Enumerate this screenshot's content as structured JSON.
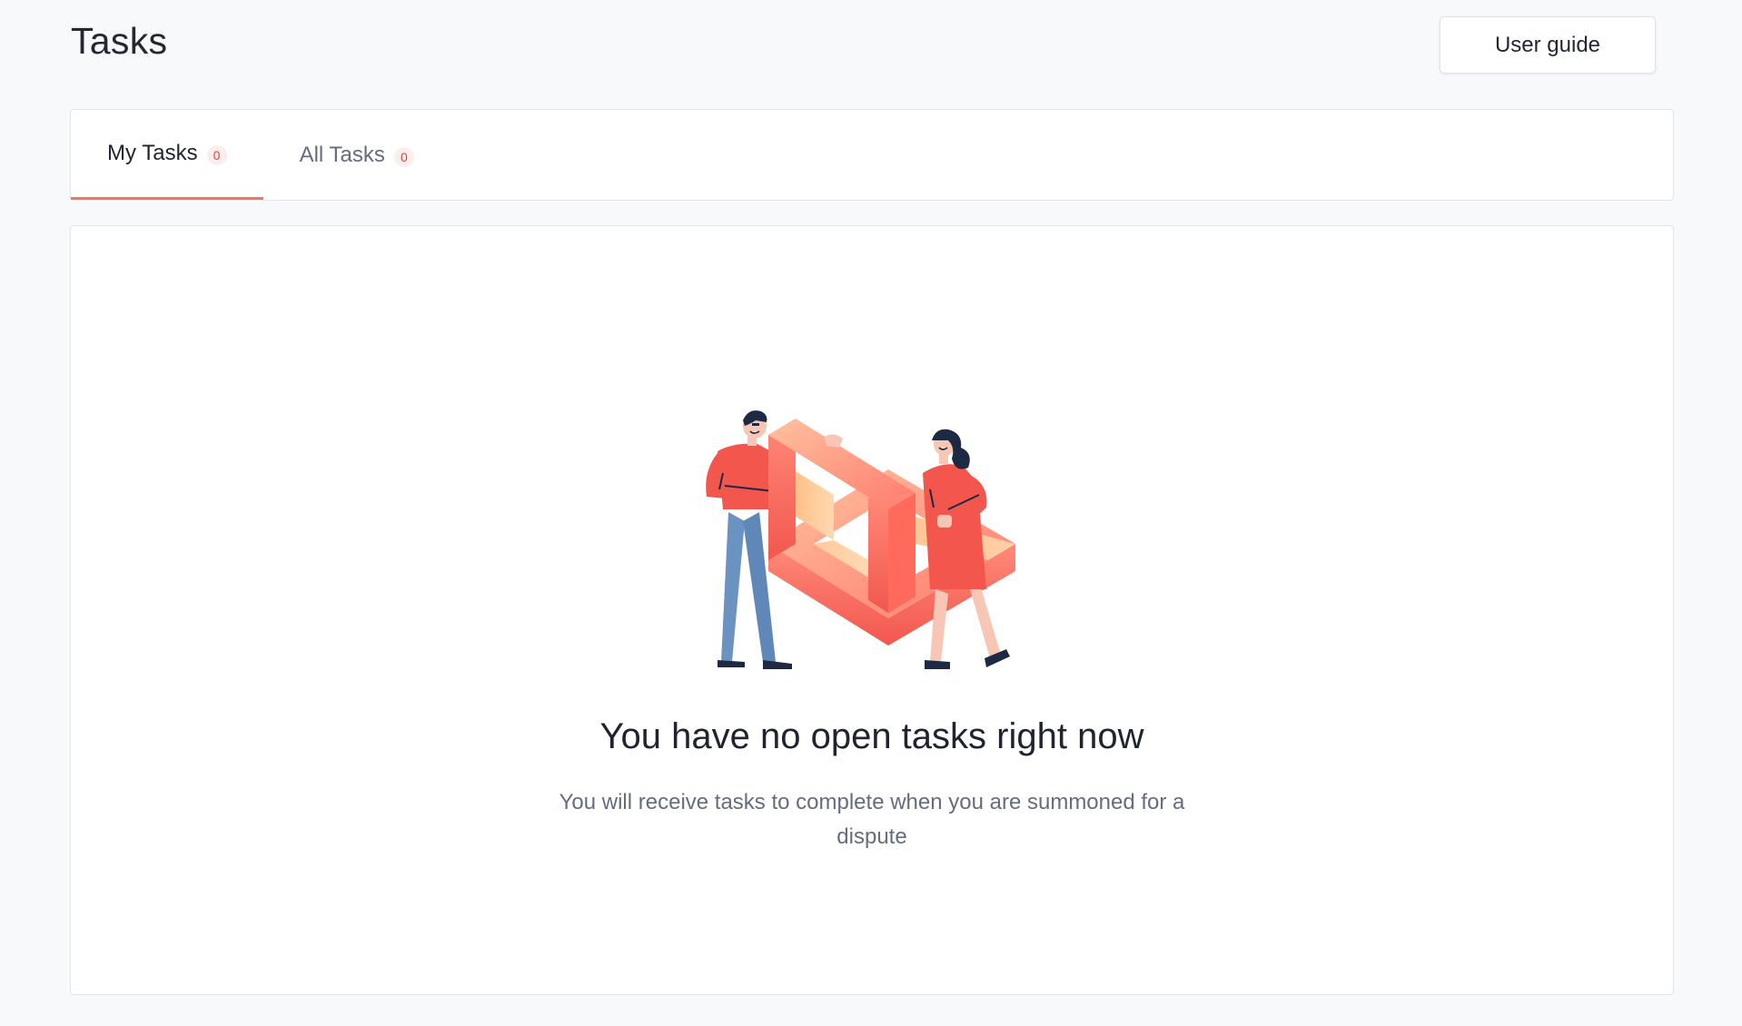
{
  "header": {
    "title": "Tasks",
    "user_guide_label": "User guide"
  },
  "tabs": [
    {
      "label": "My Tasks",
      "count": "0",
      "active": true
    },
    {
      "label": "All Tasks",
      "count": "0",
      "active": false
    }
  ],
  "empty_state": {
    "heading": "You have no open tasks right now",
    "description": "You will receive tasks to complete when you are summoned for a dispute",
    "illustration": "people-with-impossible-triangle-illustration"
  },
  "colors": {
    "accent": "#f1756a",
    "badge_bg": "#fdeeed",
    "badge_text": "#d9463b",
    "background": "#f8f9fb"
  }
}
